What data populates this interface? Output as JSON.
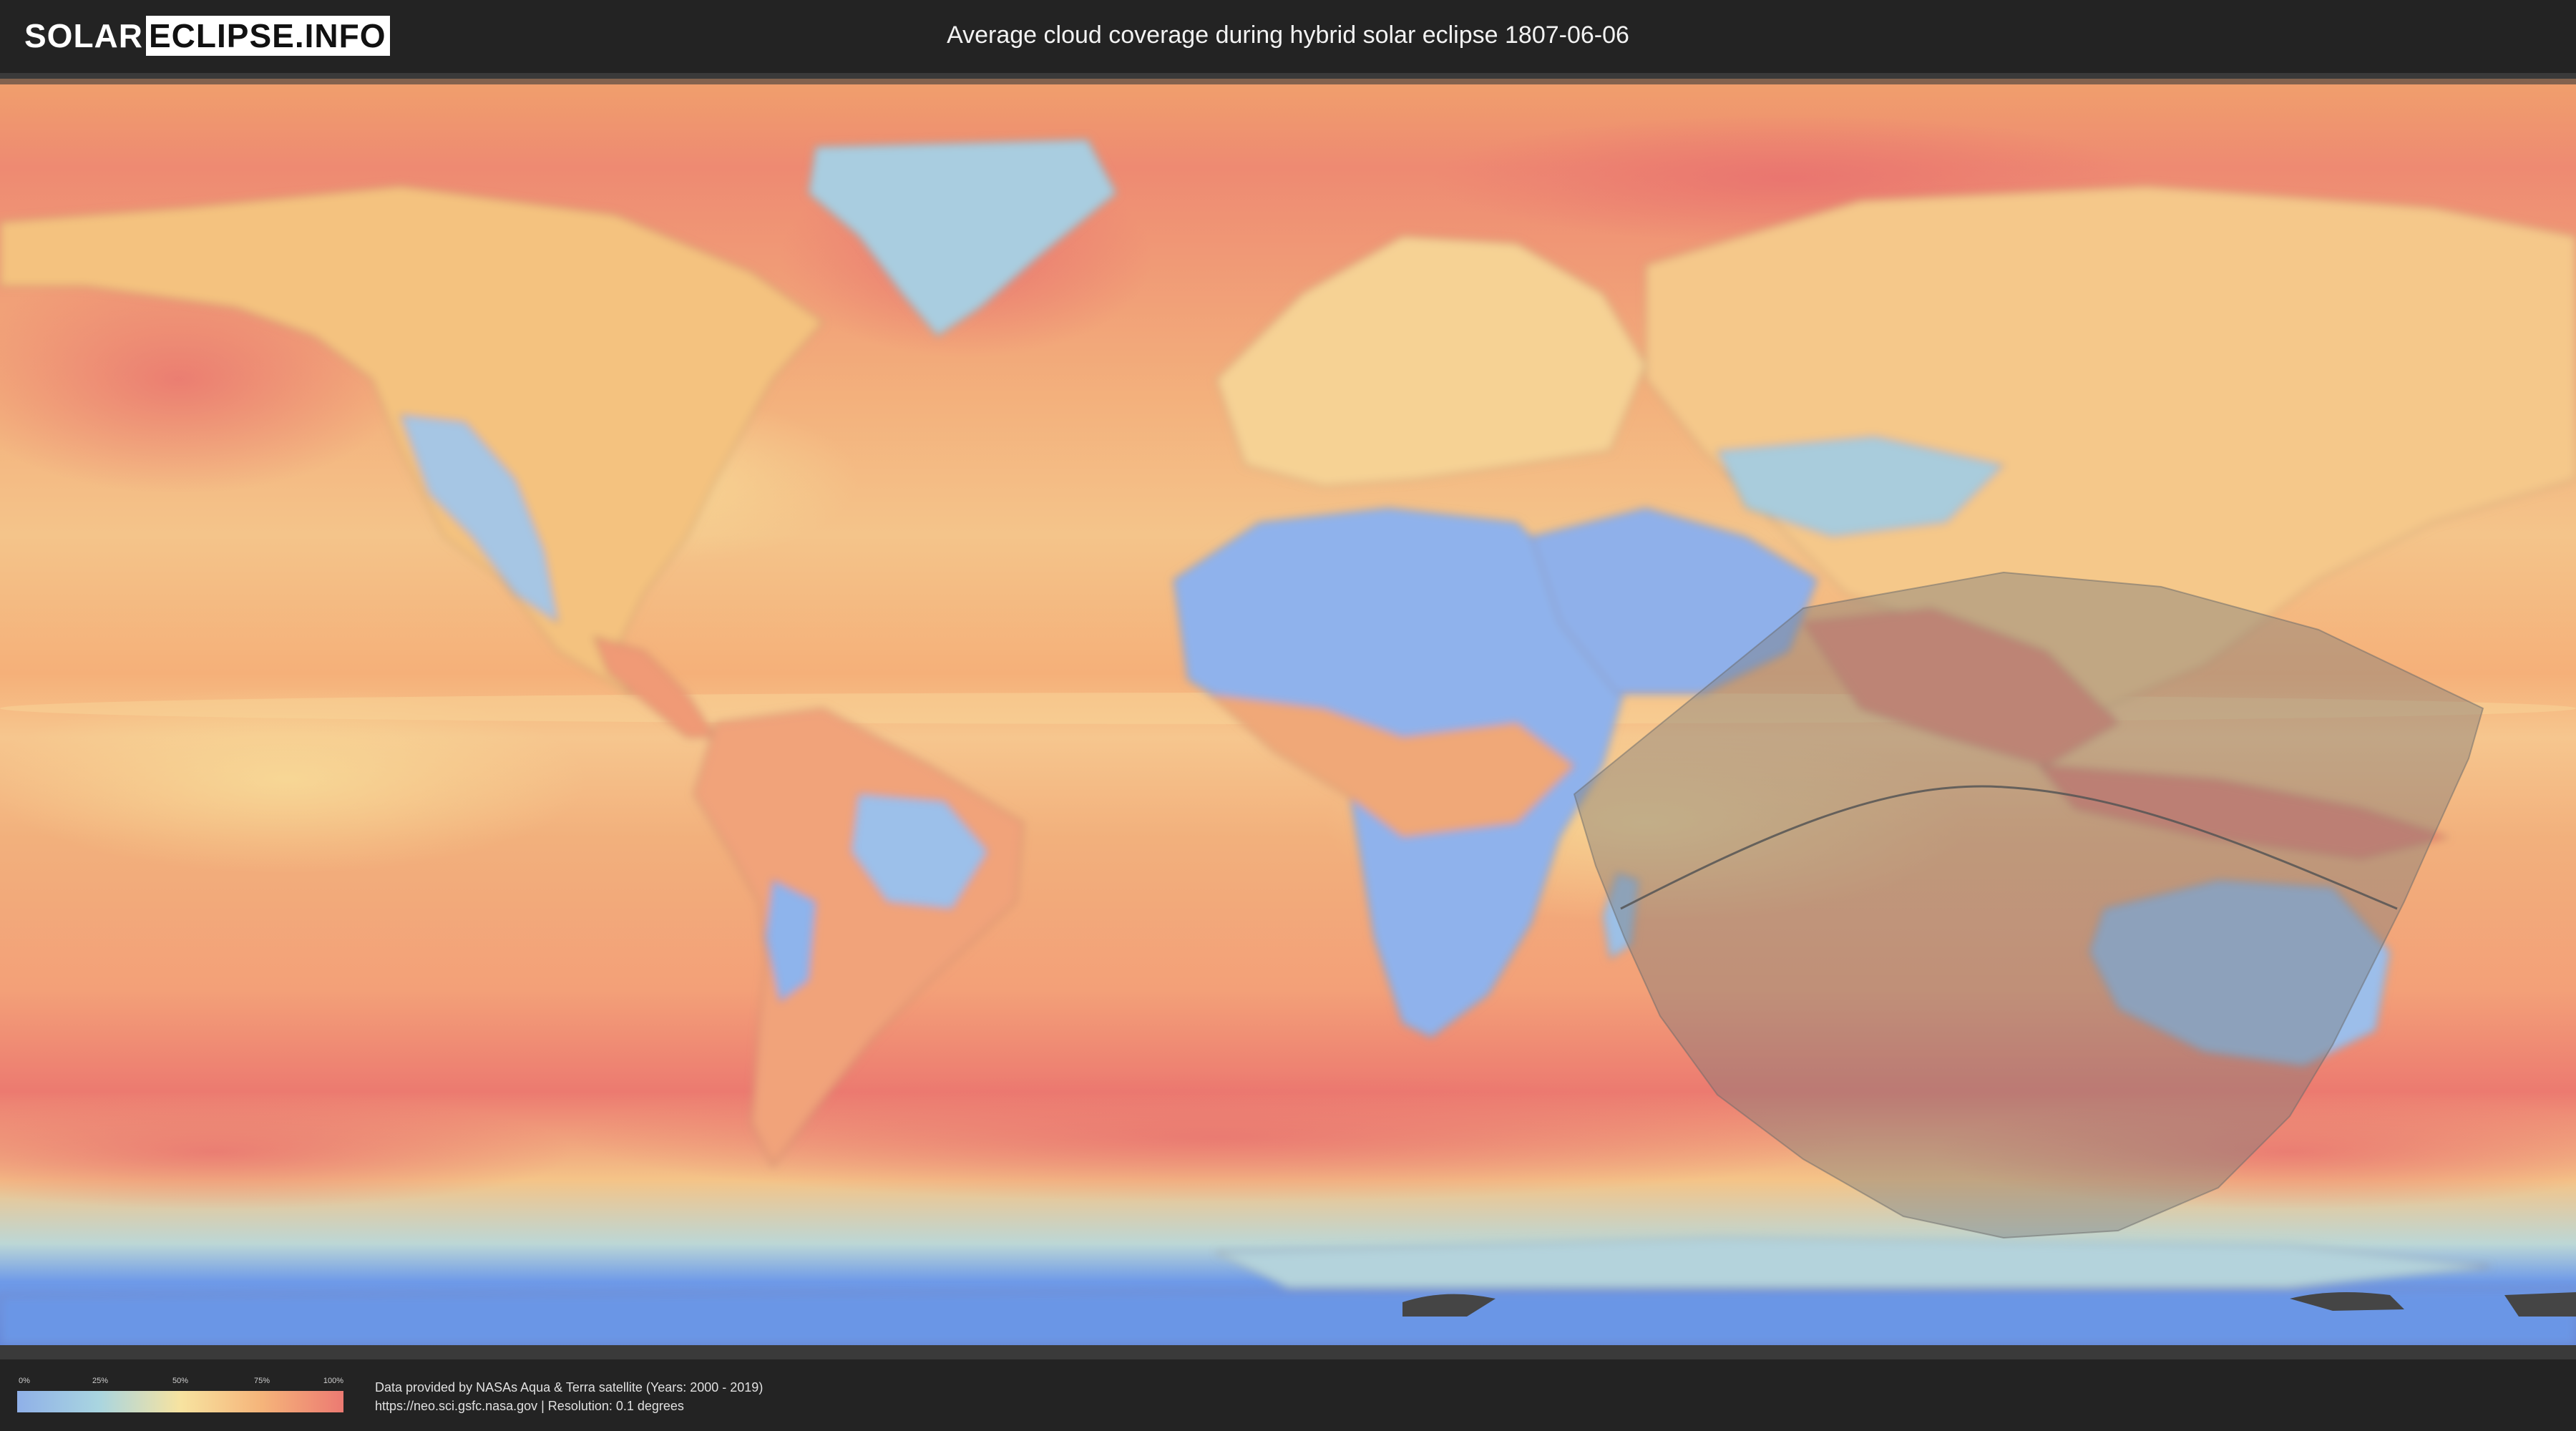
{
  "header": {
    "logo_left": "SOLAR",
    "logo_right": "ECLIPSE.INFO",
    "title": "Average cloud coverage during hybrid solar eclipse 1807-06-06"
  },
  "map": {
    "projection": "equirectangular",
    "layer": "average cloud coverage",
    "eclipse_shadow_color": "#7a7a7a",
    "path_line_color": "#555555"
  },
  "legend": {
    "ticks": [
      "0%",
      "25%",
      "50%",
      "75%",
      "100%"
    ],
    "colors": [
      "#8fb0e8",
      "#a9d5e0",
      "#f7e3a0",
      "#f5b47a",
      "#ec7a72"
    ]
  },
  "footer": {
    "credit_line1": "Data provided by NASAs Aqua & Terra satellite (Years: 2000 - 2019)",
    "credit_line2": "https://neo.sci.gsfc.nasa.gov | Resolution: 0.1 degrees"
  }
}
